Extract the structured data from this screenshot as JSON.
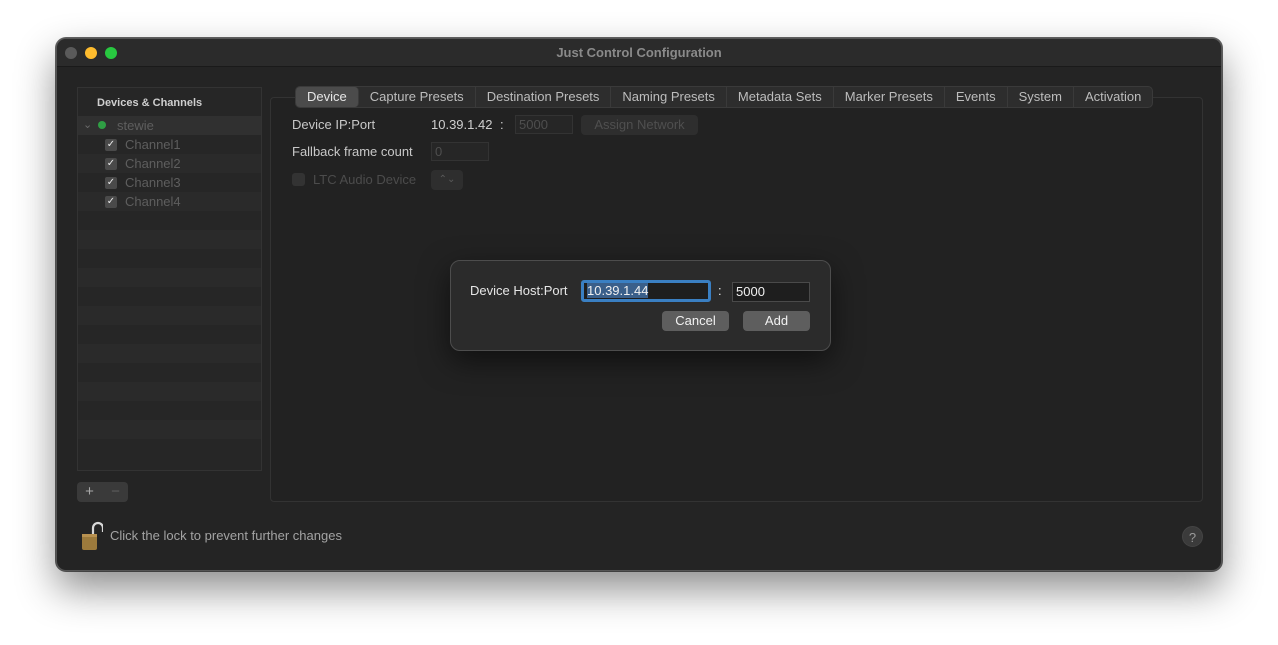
{
  "window": {
    "title": "Just Control Configuration"
  },
  "sidebar": {
    "header": "Devices & Channels",
    "device": {
      "name": "stewie",
      "status_color": "#2f9e44"
    },
    "channels": [
      {
        "label": "Channel1",
        "checked": true
      },
      {
        "label": "Channel2",
        "checked": true
      },
      {
        "label": "Channel3",
        "checked": true
      },
      {
        "label": "Channel4",
        "checked": true
      }
    ],
    "add_icon": "+",
    "remove_icon": "−"
  },
  "tabs": [
    {
      "label": "Device",
      "active": true
    },
    {
      "label": "Capture Presets"
    },
    {
      "label": "Destination Presets"
    },
    {
      "label": "Naming Presets"
    },
    {
      "label": "Metadata Sets"
    },
    {
      "label": "Marker Presets"
    },
    {
      "label": "Events"
    },
    {
      "label": "System"
    },
    {
      "label": "Activation"
    }
  ],
  "device_form": {
    "ip_label": "Device IP:Port",
    "ip_value": "10.39.1.42",
    "ip_separator": ":",
    "port_value": "5000",
    "assign_button": "Assign Network",
    "fallback_label": "Fallback frame count",
    "fallback_value": "0",
    "ltc_label": "LTC Audio Device",
    "ltc_popup_glyph": "⌃⌄"
  },
  "footer": {
    "lock_text": "Click the lock to prevent further changes",
    "help_label": "?"
  },
  "dialog": {
    "label": "Device Host:Port",
    "host_value": "10.39.1.44",
    "separator": ":",
    "port_value": "5000",
    "cancel_label": "Cancel",
    "add_label": "Add"
  },
  "colors": {
    "accent": "#3a7fc2",
    "device_status": "#2f9e44"
  }
}
